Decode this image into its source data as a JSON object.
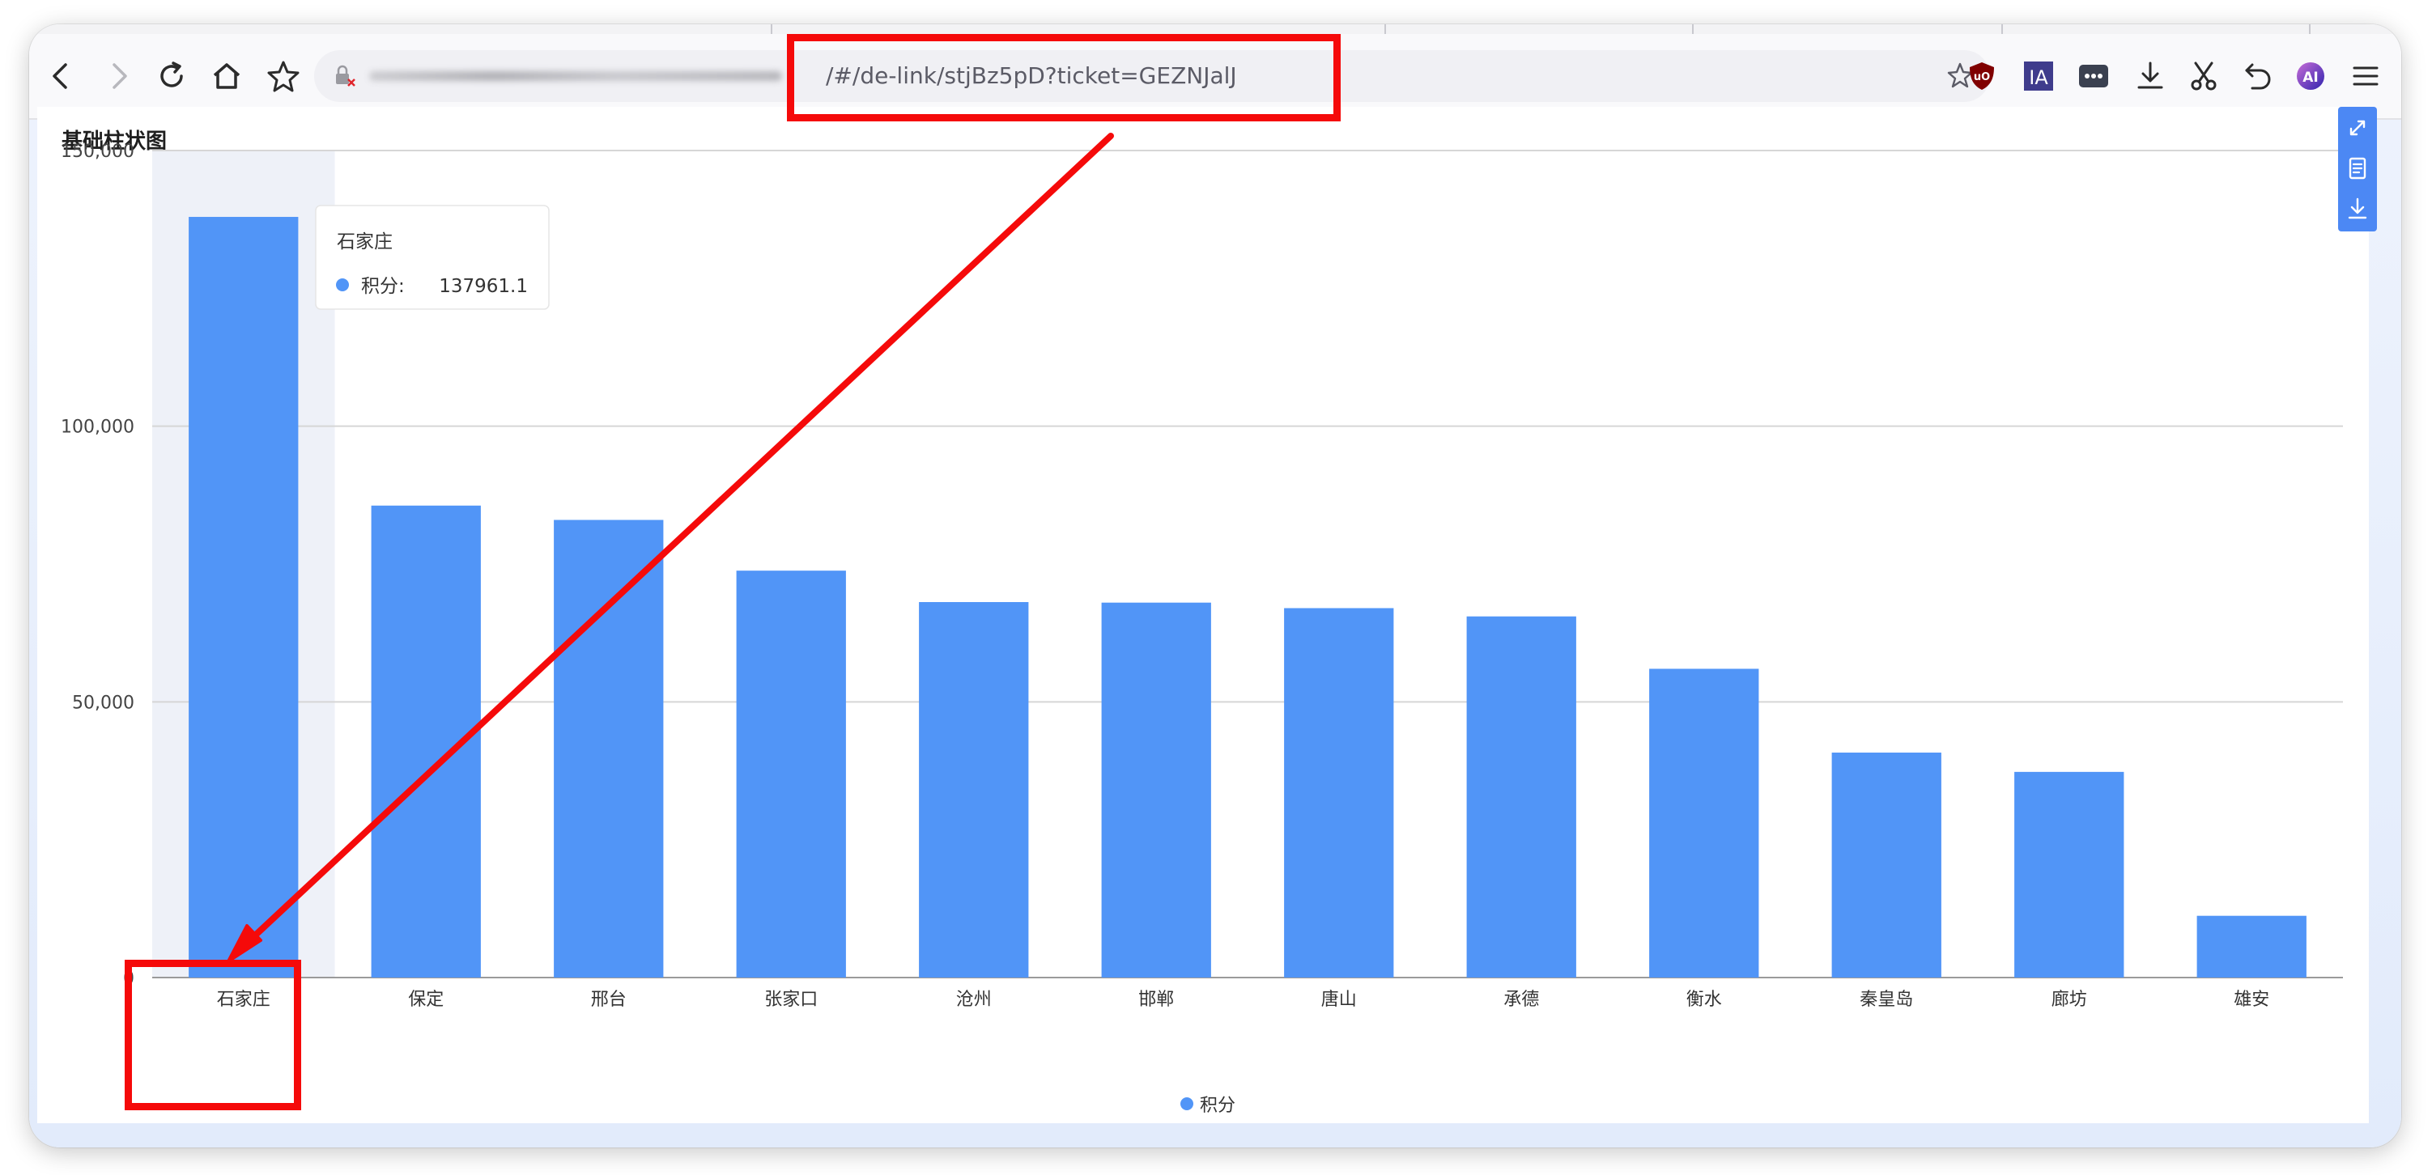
{
  "browser": {
    "url_visible": "/#/de-link/stjBz5pD?ticket=GEZNJalJ",
    "extensions": [
      "ublock-icon",
      "ia-icon",
      "more-dots-icon",
      "download-icon",
      "scissors-icon",
      "undo-icon",
      "ai-icon",
      "menu-icon"
    ],
    "ia_label": "IA",
    "ai_label": "AI"
  },
  "chart": {
    "title": "基础柱状图",
    "tooltip": {
      "category": "石家庄",
      "series": "积分:",
      "value": "137961.1"
    },
    "legend": "积分"
  },
  "chart_data": {
    "type": "bar",
    "title": "基础柱状图",
    "categories": [
      "石家庄",
      "保定",
      "邢台",
      "张家口",
      "沧州",
      "邯郸",
      "唐山",
      "承德",
      "衡水",
      "秦皇岛",
      "廊坊",
      "雄安"
    ],
    "series": [
      {
        "name": "积分",
        "values": [
          137961.1,
          85600,
          83000,
          73800,
          68100,
          68000,
          67000,
          65500,
          56000,
          40800,
          37300,
          11200
        ]
      }
    ],
    "ylim": [
      0,
      150000
    ],
    "y_ticks": [
      "0",
      "50,000",
      "100,000",
      "150,000"
    ],
    "grid": true,
    "legend_position": "bottom",
    "colors": {
      "bar": "#5195f7",
      "highlight": "#eef1f8"
    }
  },
  "annotation": {
    "color": "#f50a0a"
  }
}
